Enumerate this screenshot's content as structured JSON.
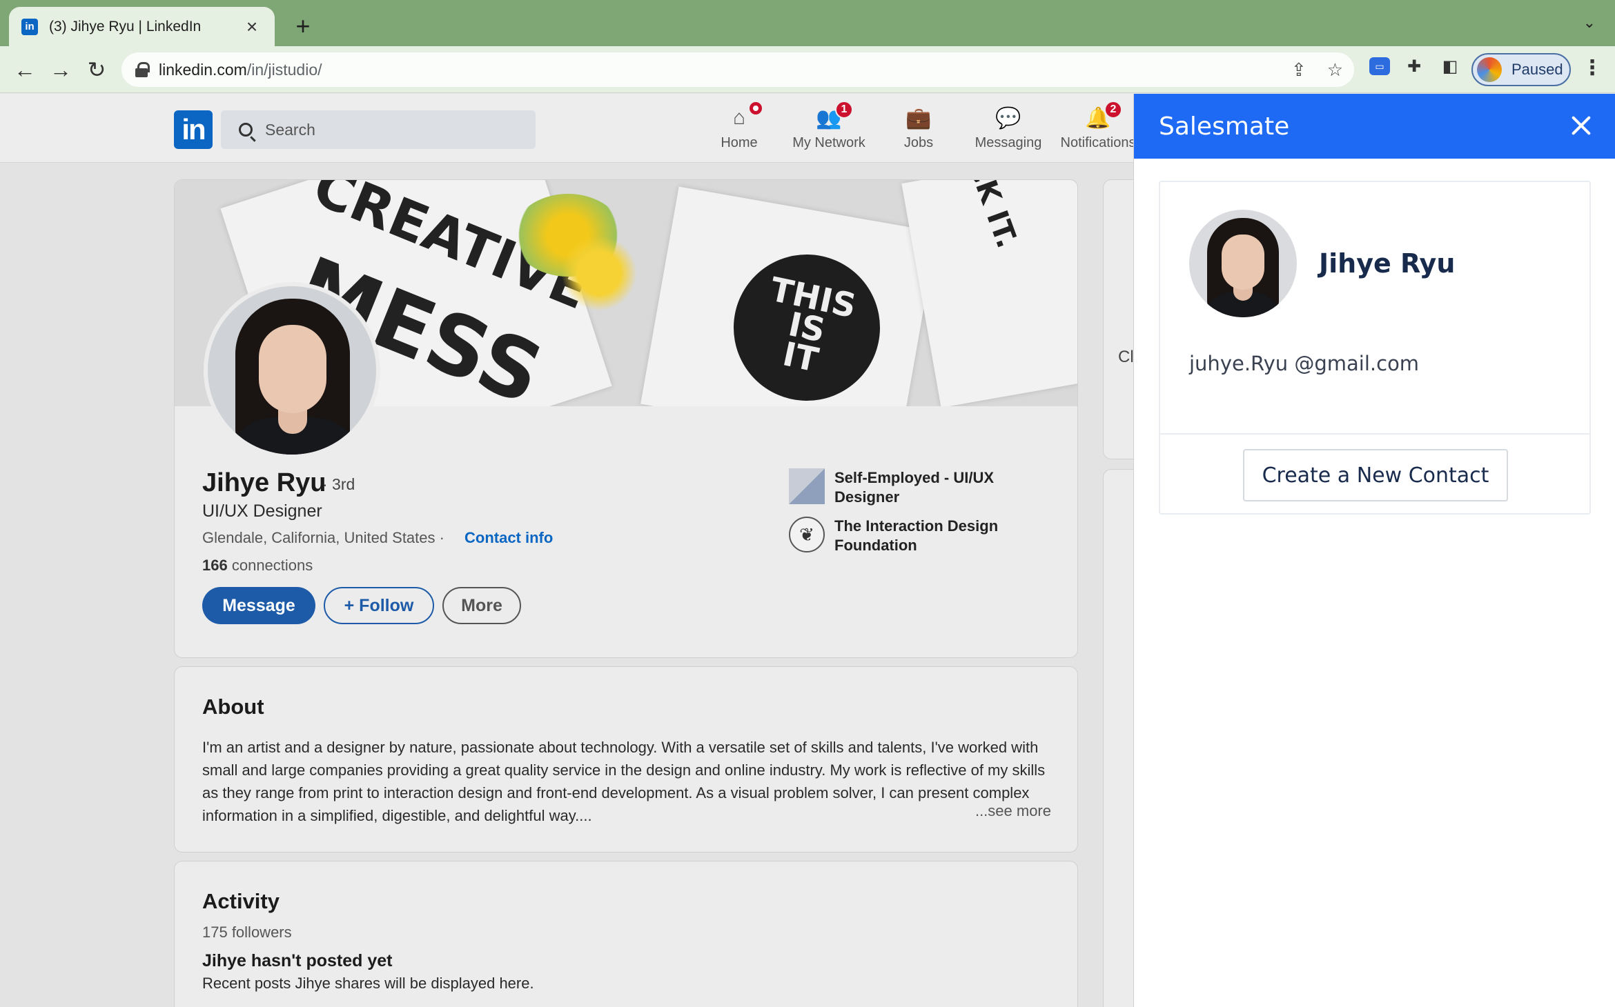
{
  "browser": {
    "tab_title": "(3) Jihye Ryu | LinkedIn",
    "tab_favicon": "in",
    "new_tab": "+",
    "tab_menu": "⌄",
    "url_host": "linkedin.com",
    "url_path": "/in/jistudio/",
    "profile_label": "Paused",
    "icons": [
      "back-icon",
      "forward-icon",
      "reload-icon",
      "lock-icon",
      "share-icon",
      "star-icon",
      "extension-icon",
      "puzzle-icon",
      "sidepanel-icon",
      "menu-icon"
    ]
  },
  "linkedin": {
    "logo": "in",
    "search_placeholder": "Search",
    "nav": [
      {
        "label": "Home",
        "badge": ""
      },
      {
        "label": "My Network",
        "badge": "1"
      },
      {
        "label": "Jobs",
        "badge": ""
      },
      {
        "label": "Messaging",
        "badge": ""
      },
      {
        "label": "Notifications",
        "badge": "2"
      }
    ],
    "cover": {
      "words_1": "CREATIVE",
      "words_2": "MESS",
      "circle_1": "THIS",
      "circle_2": "IS",
      "circle_3": "IT",
      "corner": "CK IT."
    },
    "profile": {
      "name": "Jihye Ryu",
      "degree": "· 3rd",
      "headline": "UI/UX Designer",
      "location": "Glendale, California, United States ·",
      "contact": "Contact info",
      "connections_count": "166",
      "connections_label": "connections",
      "buttons": {
        "message": "Message",
        "follow": "+ Follow",
        "more": "More"
      },
      "experience": [
        {
          "text": "Self-Employed - UI/UX Designer"
        },
        {
          "text": "The Interaction Design Foundation"
        }
      ]
    },
    "about": {
      "title": "About",
      "text": "I'm an artist and a designer by nature, passionate about technology. With a versatile set of skills and talents, I've worked with small and large companies providing a great quality service in the design and online industry. My work is reflective of my skills as they range from print to interaction design and front-end development. As a visual problem solver, I can present complex information in a simplified, digestible, and delightful way....",
      "see_more": "...see more"
    },
    "activity": {
      "title": "Activity",
      "followers": "175 followers",
      "empty_title": "Jihye hasn't posted yet",
      "empty_desc": "Recent posts Jihye shares will be displayed here."
    },
    "side_fragment": "Cl"
  },
  "salesmate": {
    "title": "Salesmate",
    "contact_name": "Jihye Ryu",
    "contact_email": "juhye.Ryu @gmail.com",
    "create_button": "Create a New Contact",
    "accent_color": "#1f6af5"
  }
}
